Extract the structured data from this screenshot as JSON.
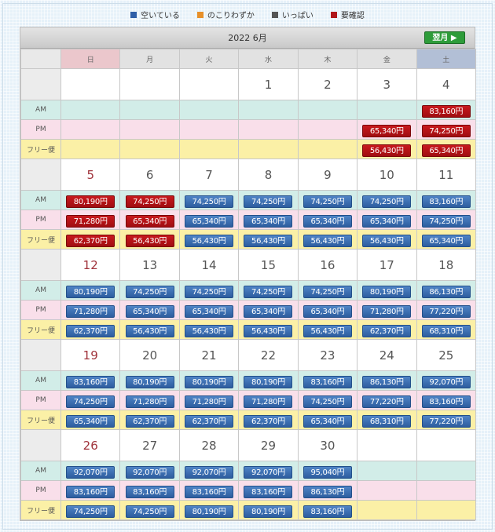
{
  "legend": [
    {
      "label": "空いている",
      "color": "#2f5fa8"
    },
    {
      "label": "のこりわずか",
      "color": "#e8902a"
    },
    {
      "label": "いっぱい",
      "color": "#555555"
    },
    {
      "label": "要確認",
      "color": "#b0161a"
    }
  ],
  "calendar": {
    "title": "2022  6月",
    "next_label": "翌月 ▶",
    "weekdays": [
      "日",
      "月",
      "火",
      "水",
      "木",
      "金",
      "土"
    ],
    "row_labels": {
      "am": "AM",
      "pm": "PM",
      "free": "フリー便"
    },
    "colors": {
      "blue": "#2d5d9f",
      "red": "#b0161a"
    },
    "weeks": [
      {
        "dates": [
          "",
          "",
          "",
          "1",
          "2",
          "3",
          "4"
        ],
        "am": [
          null,
          null,
          null,
          null,
          null,
          null,
          {
            "price": "83,160円",
            "status": "red"
          }
        ],
        "pm": [
          null,
          null,
          null,
          null,
          null,
          {
            "price": "65,340円",
            "status": "red"
          },
          {
            "price": "74,250円",
            "status": "red"
          }
        ],
        "free": [
          null,
          null,
          null,
          null,
          null,
          {
            "price": "56,430円",
            "status": "red"
          },
          {
            "price": "65,340円",
            "status": "red"
          }
        ]
      },
      {
        "dates": [
          "5",
          "6",
          "7",
          "8",
          "9",
          "10",
          "11"
        ],
        "am": [
          {
            "price": "80,190円",
            "status": "red"
          },
          {
            "price": "74,250円",
            "status": "red"
          },
          {
            "price": "74,250円",
            "status": "blue"
          },
          {
            "price": "74,250円",
            "status": "blue"
          },
          {
            "price": "74,250円",
            "status": "blue"
          },
          {
            "price": "74,250円",
            "status": "blue"
          },
          {
            "price": "83,160円",
            "status": "blue"
          }
        ],
        "pm": [
          {
            "price": "71,280円",
            "status": "red"
          },
          {
            "price": "65,340円",
            "status": "red"
          },
          {
            "price": "65,340円",
            "status": "blue"
          },
          {
            "price": "65,340円",
            "status": "blue"
          },
          {
            "price": "65,340円",
            "status": "blue"
          },
          {
            "price": "65,340円",
            "status": "blue"
          },
          {
            "price": "74,250円",
            "status": "blue"
          }
        ],
        "free": [
          {
            "price": "62,370円",
            "status": "red"
          },
          {
            "price": "56,430円",
            "status": "red"
          },
          {
            "price": "56,430円",
            "status": "blue"
          },
          {
            "price": "56,430円",
            "status": "blue"
          },
          {
            "price": "56,430円",
            "status": "blue"
          },
          {
            "price": "56,430円",
            "status": "blue"
          },
          {
            "price": "65,340円",
            "status": "blue"
          }
        ]
      },
      {
        "dates": [
          "12",
          "13",
          "14",
          "15",
          "16",
          "17",
          "18"
        ],
        "am": [
          {
            "price": "80,190円",
            "status": "blue"
          },
          {
            "price": "74,250円",
            "status": "blue"
          },
          {
            "price": "74,250円",
            "status": "blue"
          },
          {
            "price": "74,250円",
            "status": "blue"
          },
          {
            "price": "74,250円",
            "status": "blue"
          },
          {
            "price": "80,190円",
            "status": "blue"
          },
          {
            "price": "86,130円",
            "status": "blue"
          }
        ],
        "pm": [
          {
            "price": "71,280円",
            "status": "blue"
          },
          {
            "price": "65,340円",
            "status": "blue"
          },
          {
            "price": "65,340円",
            "status": "blue"
          },
          {
            "price": "65,340円",
            "status": "blue"
          },
          {
            "price": "65,340円",
            "status": "blue"
          },
          {
            "price": "71,280円",
            "status": "blue"
          },
          {
            "price": "77,220円",
            "status": "blue"
          }
        ],
        "free": [
          {
            "price": "62,370円",
            "status": "blue"
          },
          {
            "price": "56,430円",
            "status": "blue"
          },
          {
            "price": "56,430円",
            "status": "blue"
          },
          {
            "price": "56,430円",
            "status": "blue"
          },
          {
            "price": "56,430円",
            "status": "blue"
          },
          {
            "price": "62,370円",
            "status": "blue"
          },
          {
            "price": "68,310円",
            "status": "blue"
          }
        ]
      },
      {
        "dates": [
          "19",
          "20",
          "21",
          "22",
          "23",
          "24",
          "25"
        ],
        "am": [
          {
            "price": "83,160円",
            "status": "blue"
          },
          {
            "price": "80,190円",
            "status": "blue"
          },
          {
            "price": "80,190円",
            "status": "blue"
          },
          {
            "price": "80,190円",
            "status": "blue"
          },
          {
            "price": "83,160円",
            "status": "blue"
          },
          {
            "price": "86,130円",
            "status": "blue"
          },
          {
            "price": "92,070円",
            "status": "blue"
          }
        ],
        "pm": [
          {
            "price": "74,250円",
            "status": "blue"
          },
          {
            "price": "71,280円",
            "status": "blue"
          },
          {
            "price": "71,280円",
            "status": "blue"
          },
          {
            "price": "71,280円",
            "status": "blue"
          },
          {
            "price": "74,250円",
            "status": "blue"
          },
          {
            "price": "77,220円",
            "status": "blue"
          },
          {
            "price": "83,160円",
            "status": "blue"
          }
        ],
        "free": [
          {
            "price": "65,340円",
            "status": "blue"
          },
          {
            "price": "62,370円",
            "status": "blue"
          },
          {
            "price": "62,370円",
            "status": "blue"
          },
          {
            "price": "62,370円",
            "status": "blue"
          },
          {
            "price": "65,340円",
            "status": "blue"
          },
          {
            "price": "68,310円",
            "status": "blue"
          },
          {
            "price": "77,220円",
            "status": "blue"
          }
        ]
      },
      {
        "dates": [
          "26",
          "27",
          "28",
          "29",
          "30",
          "",
          ""
        ],
        "am": [
          {
            "price": "92,070円",
            "status": "blue"
          },
          {
            "price": "92,070円",
            "status": "blue"
          },
          {
            "price": "92,070円",
            "status": "blue"
          },
          {
            "price": "92,070円",
            "status": "blue"
          },
          {
            "price": "95,040円",
            "status": "blue"
          },
          null,
          null
        ],
        "pm": [
          {
            "price": "83,160円",
            "status": "blue"
          },
          {
            "price": "83,160円",
            "status": "blue"
          },
          {
            "price": "83,160円",
            "status": "blue"
          },
          {
            "price": "83,160円",
            "status": "blue"
          },
          {
            "price": "86,130円",
            "status": "blue"
          },
          null,
          null
        ],
        "free": [
          {
            "price": "74,250円",
            "status": "blue"
          },
          {
            "price": "74,250円",
            "status": "blue"
          },
          {
            "price": "80,190円",
            "status": "blue"
          },
          {
            "price": "80,190円",
            "status": "blue"
          },
          {
            "price": "83,160円",
            "status": "blue"
          },
          null,
          null
        ]
      }
    ]
  }
}
